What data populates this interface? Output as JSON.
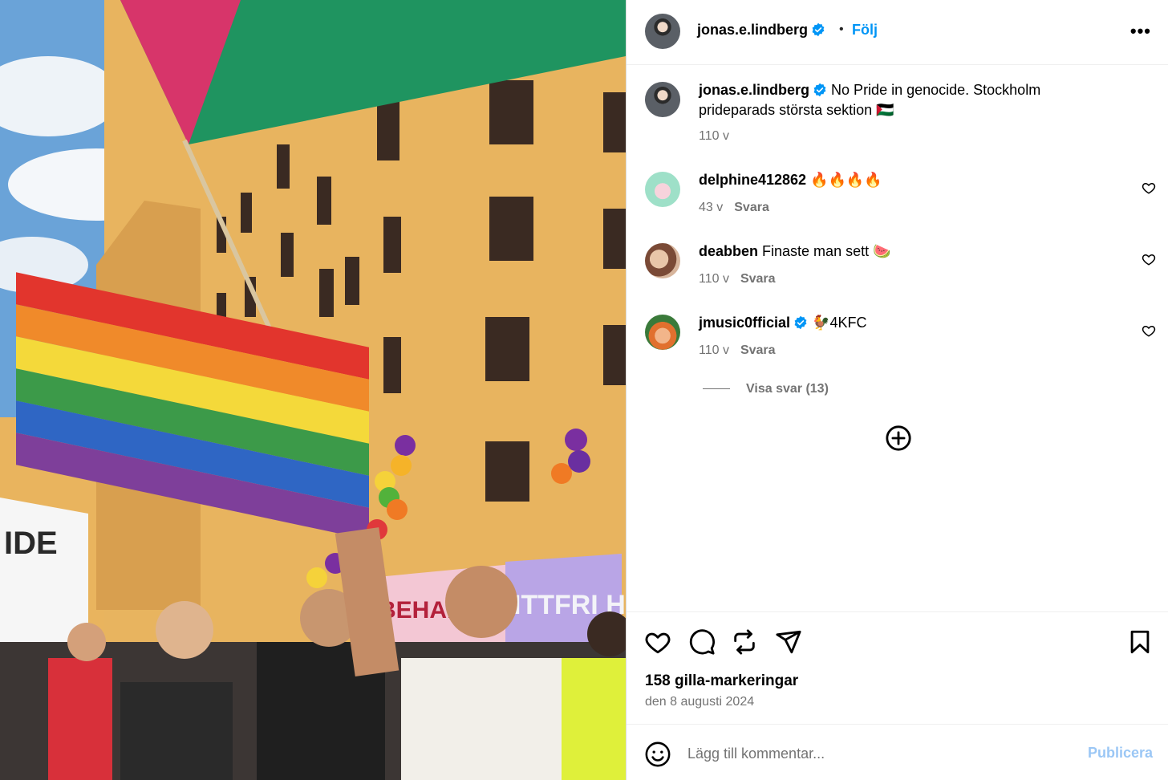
{
  "post": {
    "author": "jonas.e.lindberg",
    "follow_label": "Följ",
    "more_label": "•••",
    "caption_text": "No Pride in genocide. Stockholm prideparads största sektion 🇵🇸",
    "caption_age": "110 v"
  },
  "comments": [
    {
      "user": "delphine412862",
      "text": "🔥🔥🔥🔥",
      "age": "43 v",
      "reply": "Svara",
      "verified": false
    },
    {
      "user": "deabben",
      "text": "Finaste man sett 🍉",
      "age": "110 v",
      "reply": "Svara",
      "verified": false
    },
    {
      "user": "jmusic0fficial",
      "text": "🐓4KFC",
      "age": "110 v",
      "reply": "Svara",
      "verified": true
    }
  ],
  "view_replies": "Visa svar (13)",
  "likes": "158 gilla-markeringar",
  "date": "den 8 augusti 2024",
  "composer": {
    "placeholder": "Lägg till kommentar...",
    "publish": "Publicera"
  },
  "colors": {
    "accent": "#0095f6",
    "muted": "#737373",
    "publish_disabled": "#9bc7f5"
  }
}
